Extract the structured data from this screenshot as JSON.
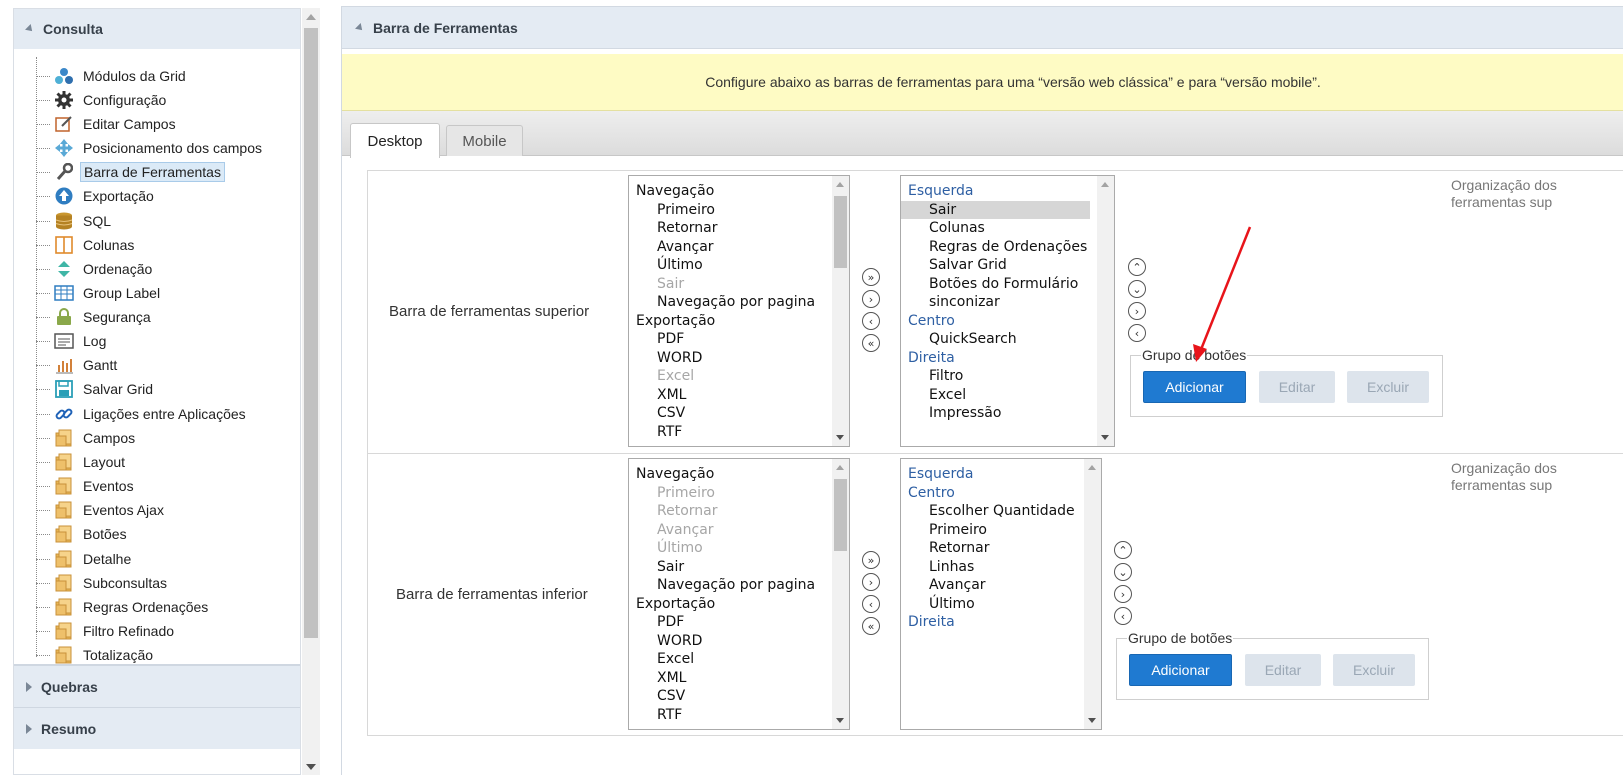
{
  "sidebar": {
    "title": "Consulta",
    "items": [
      {
        "label": "Módulos da Grid",
        "icon": "modules-icon"
      },
      {
        "label": "Configuração",
        "icon": "gear-icon"
      },
      {
        "label": "Editar Campos",
        "icon": "edit-icon"
      },
      {
        "label": "Posicionamento dos campos",
        "icon": "move-icon"
      },
      {
        "label": "Barra de Ferramentas",
        "icon": "wrench-icon"
      },
      {
        "label": "Exportação",
        "icon": "upload-icon"
      },
      {
        "label": "SQL",
        "icon": "database-icon"
      },
      {
        "label": "Colunas",
        "icon": "columns-icon"
      },
      {
        "label": "Ordenação",
        "icon": "sort-icon"
      },
      {
        "label": "Group Label",
        "icon": "table-icon"
      },
      {
        "label": "Segurança",
        "icon": "lock-icon"
      },
      {
        "label": "Log",
        "icon": "log-icon"
      },
      {
        "label": "Gantt",
        "icon": "chart-icon"
      },
      {
        "label": "Salvar Grid",
        "icon": "save-icon"
      },
      {
        "label": "Ligações entre Aplicações",
        "icon": "link-icon"
      },
      {
        "label": "Campos",
        "icon": "folder-icon"
      },
      {
        "label": "Layout",
        "icon": "folder-icon"
      },
      {
        "label": "Eventos",
        "icon": "folder-icon"
      },
      {
        "label": "Eventos Ajax",
        "icon": "folder-icon"
      },
      {
        "label": "Botões",
        "icon": "folder-icon"
      },
      {
        "label": "Detalhe",
        "icon": "folder-icon"
      },
      {
        "label": "Subconsultas",
        "icon": "folder-icon"
      },
      {
        "label": "Regras Ordenações",
        "icon": "folder-icon"
      },
      {
        "label": "Filtro Refinado",
        "icon": "folder-icon"
      },
      {
        "label": "Totalização",
        "icon": "folder-icon"
      }
    ],
    "selected": "Barra de Ferramentas",
    "section_quebras": "Quebras",
    "section_resumo": "Resumo"
  },
  "main": {
    "title": "Barra de Ferramentas",
    "notice": "Configure abaixo as barras de ferramentas para uma “versão web clássica” e para “versão mobile”.",
    "tabs": [
      {
        "label": "Desktop",
        "active": true
      },
      {
        "label": "Mobile",
        "active": false
      }
    ],
    "top": {
      "label": "Barra de ferramentas superior",
      "available": [
        {
          "text": "Navegação",
          "kind": "root"
        },
        {
          "text": "Primeiro",
          "kind": "child"
        },
        {
          "text": "Retornar",
          "kind": "child"
        },
        {
          "text": "Avançar",
          "kind": "child"
        },
        {
          "text": "Último",
          "kind": "child"
        },
        {
          "text": "Sair",
          "kind": "disabled"
        },
        {
          "text": "Navegação por pagina",
          "kind": "child"
        },
        {
          "text": "Exportação",
          "kind": "root"
        },
        {
          "text": "PDF",
          "kind": "child"
        },
        {
          "text": "WORD",
          "kind": "child"
        },
        {
          "text": "Excel",
          "kind": "disabled"
        },
        {
          "text": "XML",
          "kind": "child"
        },
        {
          "text": "CSV",
          "kind": "child"
        },
        {
          "text": "RTF",
          "kind": "child"
        }
      ],
      "selected": [
        {
          "text": "Esquerda",
          "kind": "group"
        },
        {
          "text": "Sair",
          "kind": "sel"
        },
        {
          "text": "Colunas",
          "kind": "child"
        },
        {
          "text": "Regras de Ordenações",
          "kind": "child"
        },
        {
          "text": "Salvar Grid",
          "kind": "child"
        },
        {
          "text": "Botões do Formulário",
          "kind": "child"
        },
        {
          "text": "sinconizar",
          "kind": "child"
        },
        {
          "text": "Centro",
          "kind": "group"
        },
        {
          "text": "QuickSearch",
          "kind": "child"
        },
        {
          "text": "Direita",
          "kind": "group"
        },
        {
          "text": "Filtro",
          "kind": "child"
        },
        {
          "text": "Excel",
          "kind": "child"
        },
        {
          "text": "Impressão",
          "kind": "child"
        }
      ],
      "group_legend": "Grupo de botões",
      "btn_add": "Adicionar",
      "btn_edit": "Editar",
      "btn_delete": "Excluir",
      "org_line1": "Organização dos",
      "org_line2": "ferramentas sup"
    },
    "bottom": {
      "label": "Barra de ferramentas inferior",
      "available": [
        {
          "text": "Navegação",
          "kind": "root"
        },
        {
          "text": "Primeiro",
          "kind": "disabled"
        },
        {
          "text": "Retornar",
          "kind": "disabled"
        },
        {
          "text": "Avançar",
          "kind": "disabled"
        },
        {
          "text": "Último",
          "kind": "disabled"
        },
        {
          "text": "Sair",
          "kind": "child"
        },
        {
          "text": "Navegação por pagina",
          "kind": "child"
        },
        {
          "text": "Exportação",
          "kind": "root"
        },
        {
          "text": "PDF",
          "kind": "child"
        },
        {
          "text": "WORD",
          "kind": "child"
        },
        {
          "text": "Excel",
          "kind": "child"
        },
        {
          "text": "XML",
          "kind": "child"
        },
        {
          "text": "CSV",
          "kind": "child"
        },
        {
          "text": "RTF",
          "kind": "child"
        }
      ],
      "selected": [
        {
          "text": "Esquerda",
          "kind": "group"
        },
        {
          "text": "Centro",
          "kind": "group"
        },
        {
          "text": "Escolher Quantidade",
          "kind": "child"
        },
        {
          "text": "Primeiro",
          "kind": "child"
        },
        {
          "text": "Retornar",
          "kind": "child"
        },
        {
          "text": "Linhas",
          "kind": "child"
        },
        {
          "text": "Avançar",
          "kind": "child"
        },
        {
          "text": "Último",
          "kind": "child"
        },
        {
          "text": "Direita",
          "kind": "group"
        }
      ],
      "group_legend": "Grupo de botões",
      "btn_add": "Adicionar",
      "btn_edit": "Editar",
      "btn_delete": "Excluir",
      "org_line1": "Organização dos",
      "org_line2": "ferramentas sup"
    },
    "transfer_buttons": [
      "»",
      "›",
      "‹",
      "«"
    ],
    "order_buttons": [
      "⌃",
      "⌄",
      "›",
      "‹"
    ]
  },
  "colors": {
    "accent": "#1f7ad1",
    "group_text": "#2e5fa3",
    "annotation_arrow": "#e8141a"
  }
}
